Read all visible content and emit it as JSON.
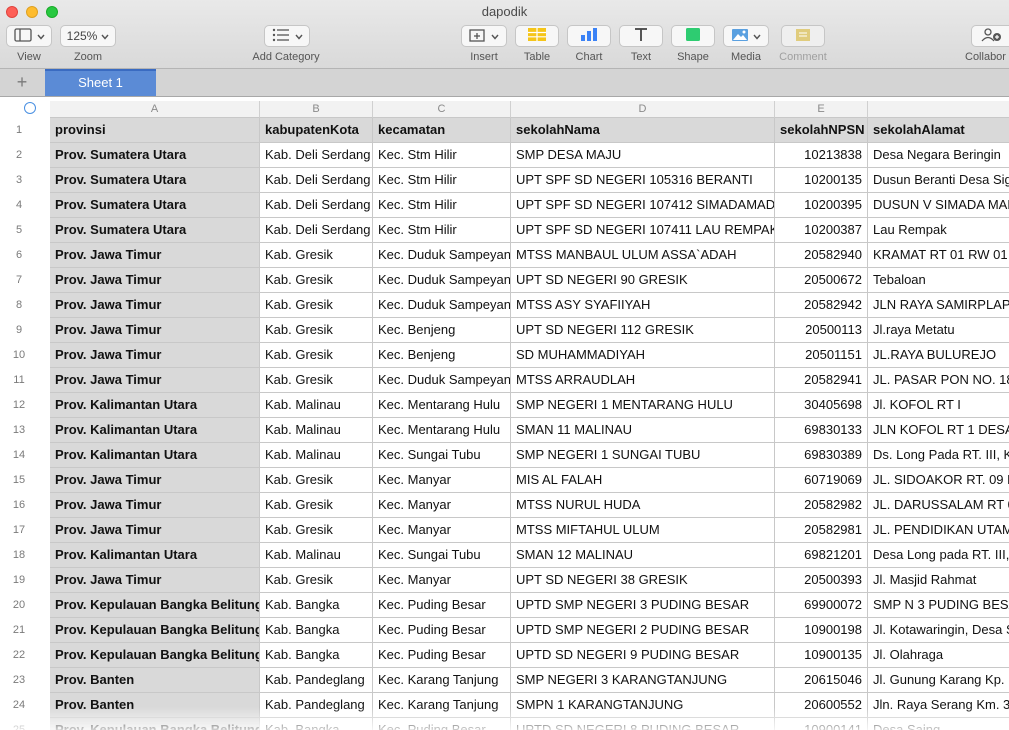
{
  "window": {
    "title": "dapodik"
  },
  "toolbar": {
    "view_label": "View",
    "zoom_value": "125%",
    "zoom_label": "Zoom",
    "add_category_label": "Add Category",
    "insert_label": "Insert",
    "table_label": "Table",
    "chart_label": "Chart",
    "text_label": "Text",
    "shape_label": "Shape",
    "media_label": "Media",
    "comment_label": "Comment",
    "collaborate_label": "Collabor",
    "icons": {
      "view": "sidebar-icon",
      "add_category": "list-icon",
      "insert": "insert-icon",
      "table": "table-icon",
      "chart": "chart-icon",
      "text": "text-icon",
      "shape": "shape-icon",
      "media": "media-icon",
      "comment": "comment-icon",
      "collaborate": "collaborate-icon"
    },
    "accent_colors": {
      "table": "#f5c518",
      "chart": "#3b82f6",
      "shape": "#2ecc71",
      "media": "#5aa0e0",
      "comment": "#d6b430"
    }
  },
  "sheets": {
    "add_label": "+",
    "tabs": [
      "Sheet 1"
    ]
  },
  "columns": [
    "A",
    "B",
    "C",
    "D",
    "E"
  ],
  "table": {
    "headers": [
      "provinsi",
      "kabupatenKota",
      "kecamatan",
      "sekolahNama",
      "sekolahNPSN",
      "sekolahAlamat"
    ],
    "header_row_number": "1",
    "rows": [
      {
        "n": "2",
        "c": [
          "Prov. Sumatera Utara",
          "Kab. Deli Serdang",
          "Kec. Stm Hilir",
          "SMP DESA MAJU",
          "10213838",
          "Desa Negara Beringin"
        ]
      },
      {
        "n": "3",
        "c": [
          "Prov. Sumatera Utara",
          "Kab. Deli Serdang",
          "Kec. Stm Hilir",
          "UPT SPF SD NEGERI 105316 BERANTI",
          "10200135",
          "Dusun Beranti Desa Sig"
        ]
      },
      {
        "n": "4",
        "c": [
          "Prov. Sumatera Utara",
          "Kab. Deli Serdang",
          "Kec. Stm Hilir",
          "UPT SPF SD NEGERI 107412 SIMADAMADA",
          "10200395",
          "DUSUN V SIMADA MAD"
        ]
      },
      {
        "n": "5",
        "c": [
          "Prov. Sumatera Utara",
          "Kab. Deli Serdang",
          "Kec. Stm Hilir",
          "UPT SPF SD NEGERI 107411 LAU REMPAK",
          "10200387",
          "Lau Rempak"
        ]
      },
      {
        "n": "6",
        "c": [
          "Prov. Jawa Timur",
          "Kab. Gresik",
          "Kec. Duduk Sampeyan",
          "MTSS MANBAUL ULUM ASSA`ADAH",
          "20582940",
          "KRAMAT RT 01 RW 01"
        ]
      },
      {
        "n": "7",
        "c": [
          "Prov. Jawa Timur",
          "Kab. Gresik",
          "Kec. Duduk Sampeyan",
          "UPT SD NEGERI 90 GRESIK",
          "20500672",
          "Tebaloan"
        ]
      },
      {
        "n": "8",
        "c": [
          "Prov. Jawa Timur",
          "Kab. Gresik",
          "Kec. Duduk Sampeyan",
          "MTSS ASY SYAFIIYAH",
          "20582942",
          "JLN RAYA SAMIRPLAPA"
        ]
      },
      {
        "n": "9",
        "c": [
          "Prov. Jawa Timur",
          "Kab. Gresik",
          "Kec. Benjeng",
          "UPT SD NEGERI 112 GRESIK",
          "20500113",
          "Jl.raya Metatu"
        ]
      },
      {
        "n": "10",
        "c": [
          "Prov. Jawa Timur",
          "Kab. Gresik",
          "Kec. Benjeng",
          "SD MUHAMMADIYAH",
          "20501151",
          "JL.RAYA BULUREJO"
        ]
      },
      {
        "n": "11",
        "c": [
          "Prov. Jawa Timur",
          "Kab. Gresik",
          "Kec. Duduk Sampeyan",
          "MTSS ARRAUDLAH",
          "20582941",
          "JL. PASAR PON NO. 18"
        ]
      },
      {
        "n": "12",
        "c": [
          "Prov. Kalimantan Utara",
          "Kab. Malinau",
          "Kec. Mentarang Hulu",
          "SMP NEGERI 1 MENTARANG HULU",
          "30405698",
          "Jl. KOFOL RT I"
        ]
      },
      {
        "n": "13",
        "c": [
          "Prov. Kalimantan Utara",
          "Kab. Malinau",
          "Kec. Mentarang Hulu",
          "SMAN 11 MALINAU",
          "69830133",
          "JLN KOFOL RT 1 DESA"
        ]
      },
      {
        "n": "14",
        "c": [
          "Prov. Kalimantan Utara",
          "Kab. Malinau",
          "Kec. Sungai Tubu",
          "SMP NEGERI 1 SUNGAI TUBU",
          "69830389",
          "Ds. Long Pada RT. III, K"
        ]
      },
      {
        "n": "15",
        "c": [
          "Prov. Jawa Timur",
          "Kab. Gresik",
          "Kec. Manyar",
          "MIS AL FALAH",
          "60719069",
          "JL. SIDOAKOR RT. 09 R"
        ]
      },
      {
        "n": "16",
        "c": [
          "Prov. Jawa Timur",
          "Kab. Gresik",
          "Kec. Manyar",
          "MTSS NURUL HUDA",
          "20582982",
          "JL. DARUSSALAM RT 0"
        ]
      },
      {
        "n": "17",
        "c": [
          "Prov. Jawa Timur",
          "Kab. Gresik",
          "Kec. Manyar",
          "MTSS MIFTAHUL ULUM",
          "20582981",
          "JL. PENDIDIKAN UTAM."
        ]
      },
      {
        "n": "18",
        "c": [
          "Prov. Kalimantan Utara",
          "Kab. Malinau",
          "Kec. Sungai Tubu",
          "SMAN 12 MALINAU",
          "69821201",
          "Desa Long pada RT. III,"
        ]
      },
      {
        "n": "19",
        "c": [
          "Prov. Jawa Timur",
          "Kab. Gresik",
          "Kec. Manyar",
          "UPT SD NEGERI 38 GRESIK",
          "20500393",
          "Jl. Masjid Rahmat"
        ]
      },
      {
        "n": "20",
        "c": [
          "Prov. Kepulauan Bangka Belitung",
          "Kab. Bangka",
          "Kec. Puding Besar",
          "UPTD SMP NEGERI 3 PUDING BESAR",
          "69900072",
          "SMP N 3 PUDING BESA"
        ]
      },
      {
        "n": "21",
        "c": [
          "Prov. Kepulauan Bangka Belitung",
          "Kab. Bangka",
          "Kec. Puding Besar",
          "UPTD SMP NEGERI 2 PUDING BESAR",
          "10900198",
          "Jl. Kotawaringin, Desa S"
        ]
      },
      {
        "n": "22",
        "c": [
          "Prov. Kepulauan Bangka Belitung",
          "Kab. Bangka",
          "Kec. Puding Besar",
          "UPTD SD NEGERI 9 PUDING BESAR",
          "10900135",
          "Jl. Olahraga"
        ]
      },
      {
        "n": "23",
        "c": [
          "Prov. Banten",
          "Kab. Pandeglang",
          "Kec. Karang Tanjung",
          "SMP NEGERI 3 KARANGTANJUNG",
          "20615046",
          " Jl. Gunung Karang Kp."
        ]
      },
      {
        "n": "24",
        "c": [
          "Prov. Banten",
          "Kab. Pandeglang",
          "Kec. Karang Tanjung",
          "SMPN 1 KARANGTANJUNG",
          "20600552",
          "Jln. Raya Serang Km. 3"
        ]
      },
      {
        "n": "25",
        "c": [
          "Prov. Kepulauan Bangka Belitung",
          "Kab. Bangka",
          "Kec. Puding Besar",
          "UPTD SD NEGERI 8 PUDING BESAR",
          "10900141",
          "Desa Saing"
        ]
      }
    ]
  }
}
